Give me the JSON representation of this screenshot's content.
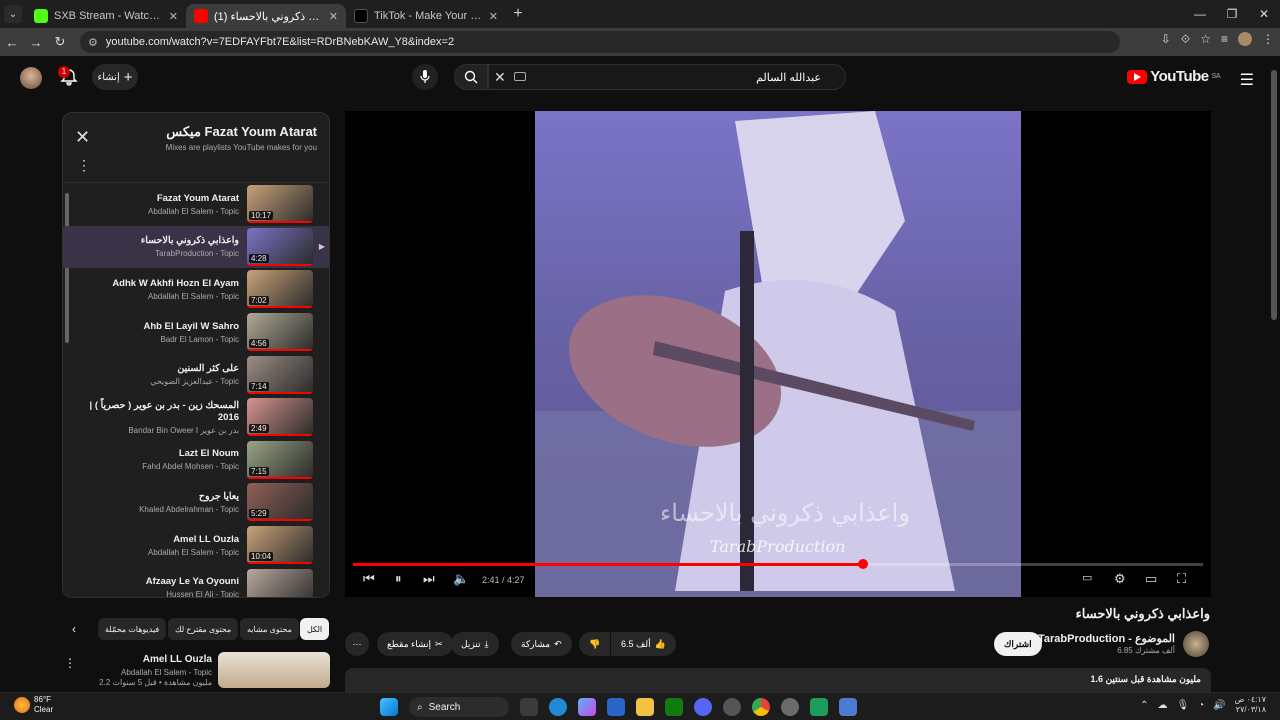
{
  "browser": {
    "tabs": [
      {
        "title": "SXB Stream - Watch Live on Ki",
        "color": "#53fc18",
        "active": false
      },
      {
        "title": "(1) واعذابي ذكروني بالاحساء",
        "color": "#ff0000",
        "active": true
      },
      {
        "title": "TikTok - Make Your Day",
        "color": "#000000",
        "active": false
      }
    ],
    "url": "youtube.com/watch?v=7EDFAYFbt7E&list=RDrBNebKAW_Y8&index=2"
  },
  "youtube": {
    "logo": "YouTube",
    "logo_region": "SA",
    "search_value": "عبدالله السالم",
    "create_label": "إنشاء",
    "notif_count": "1"
  },
  "playlist": {
    "title": "ميكس Fazat Youm Atarat",
    "subtitle": "Mixes are playlists YouTube makes for you",
    "items": [
      {
        "title": "Fazat Youm Atarat",
        "channel": "Abdallah El Salem - Topic",
        "duration": "10:17",
        "thumb": "#c8a27a",
        "active": false
      },
      {
        "title": "واعذابي ذكروني بالاحساء",
        "channel": "TarabProduction - Topic",
        "duration": "4:28",
        "thumb": "#7b74c7",
        "active": true
      },
      {
        "title": "Adhk W Akhfi Hozn El Ayam",
        "channel": "Abdallah El Salem - Topic",
        "duration": "7:02",
        "thumb": "#c8a27a",
        "active": false
      },
      {
        "title": "Ahb El Layil W Sahro",
        "channel": "Badr El Lamon - Topic",
        "duration": "4:56",
        "thumb": "#b0aa95",
        "active": false
      },
      {
        "title": "على كثر السنين",
        "channel": "عبدالعزيز الضويحي - Topic",
        "duration": "7:14",
        "thumb": "#9c8d85",
        "active": false
      },
      {
        "title": "المسحك زين - بدر بن عوير ( حصرياً ) | 2016",
        "channel": "Bandar Bin Oweer I بدر بن عوير",
        "duration": "2:49",
        "thumb": "#d6948e",
        "active": false
      },
      {
        "title": "Lazt El Noum",
        "channel": "Fahd Abdel Mohsen - Topic",
        "duration": "7:15",
        "thumb": "#9aa486",
        "active": false
      },
      {
        "title": "يعايا جروح",
        "channel": "Khaled Abdelrahman - Topic",
        "duration": "5:29",
        "thumb": "#8f6157",
        "active": false
      },
      {
        "title": "Amel LL Ouzla",
        "channel": "Abdallah El Salem - Topic",
        "duration": "10:04",
        "thumb": "#c8a27a",
        "active": false
      },
      {
        "title": "Afzaay Le Ya Oyouni",
        "channel": "Hussen El Ali - Topic",
        "duration": "",
        "thumb": "#b9a89e",
        "active": false
      }
    ]
  },
  "video": {
    "caption_ar": "واعذابي ذكروني بالاحساء",
    "caption_en": "TarabProduction",
    "time": "2:41 / 4:27",
    "progress": 0.6,
    "title": "واعذابي ذكروني بالاحساء",
    "channel": "TarabProduction - الموضوع",
    "subs": "6.85 ألف مشترك",
    "subscribe": "اشتراك",
    "likes": "6.5 ألف",
    "share": "مشاركة",
    "download": "تنزيل",
    "clip": "إنشاء مقطع",
    "desc": "1.6 مليون مشاهدة قبل سنتين"
  },
  "chips": [
    "الكل",
    "محتوى مشابه",
    "محتوى مقترح لك",
    "فيديوهات محمّلة"
  ],
  "rec": {
    "title": "Amel LL Ouzla",
    "channel": "Abdallah El Salem - Topic",
    "views": "2.2 مليون مشاهدة • قبل 5 سنوات"
  },
  "taskbar": {
    "temp": "86°F",
    "weather": "Clear",
    "search": "Search",
    "time": "٠٤:١٧ ص",
    "date": "٢٧/٠٣/١٨"
  }
}
